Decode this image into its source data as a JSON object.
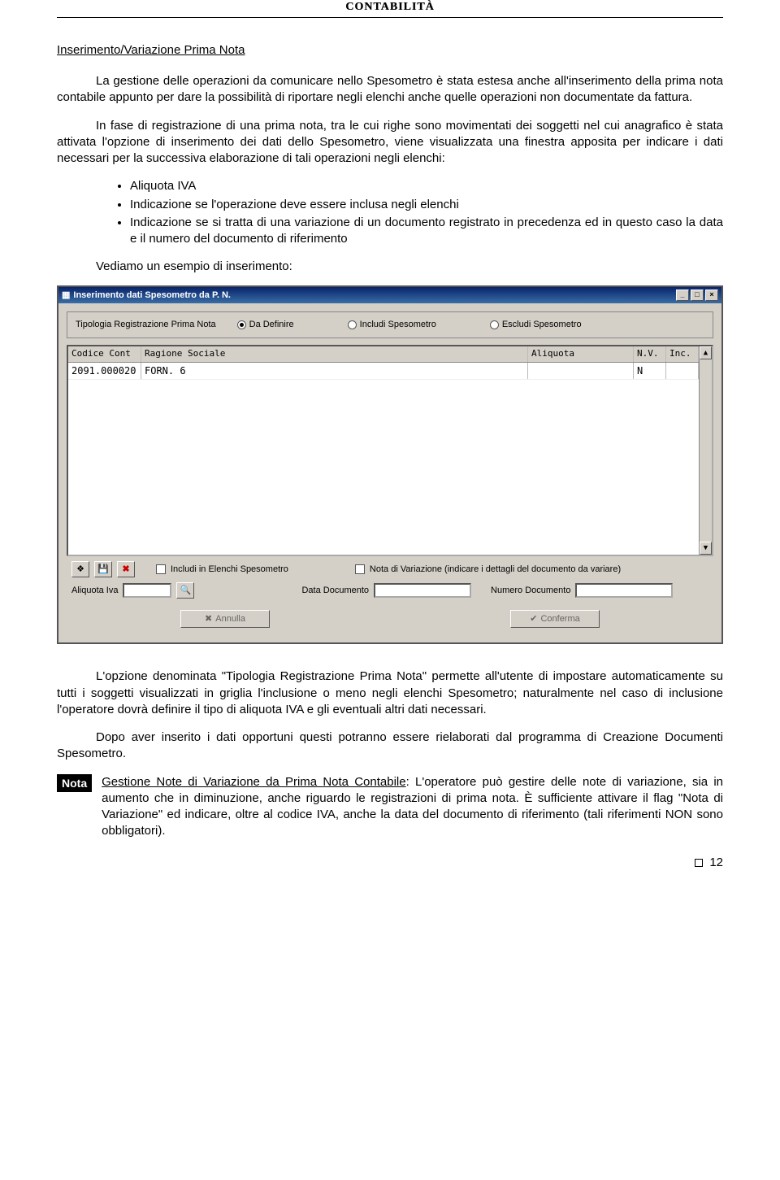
{
  "header": {
    "title": "CONTABILITÀ"
  },
  "section1": {
    "title": "Inserimento/Variazione Prima Nota",
    "p1": "La gestione delle operazioni da comunicare nello Spesometro è stata estesa anche all'inserimento della prima nota contabile appunto per dare la possibilità di riportare negli elenchi anche quelle operazioni non documentate da fattura.",
    "p2": "In fase di registrazione di una prima nota, tra le cui righe sono movimentati dei soggetti nel cui anagrafico è stata attivata l'opzione di inserimento dei dati dello Spesometro, viene visualizzata una finestra apposita per indicare i dati necessari per la successiva elaborazione di tali operazioni negli elenchi:",
    "bullets": [
      "Aliquota IVA",
      "Indicazione se l'operazione deve essere inclusa negli elenchi",
      "Indicazione se si tratta di una variazione di un documento registrato in precedenza ed in questo caso la data e il numero del documento di riferimento"
    ],
    "example": "Vediamo un esempio di inserimento:"
  },
  "dialog": {
    "title": "Inserimento dati Spesometro da P. N.",
    "radioLabel": "Tipologia Registrazione Prima Nota",
    "radios": [
      "Da Definire",
      "Includi Spesometro",
      "Escludi Spesometro"
    ],
    "cols": {
      "code": "Codice Cont",
      "rag": "Ragione Sociale",
      "aliq": "Aliquota",
      "nv": "N.V.",
      "inc": "Inc."
    },
    "row": {
      "code": "2091.000020",
      "rag": "FORN. 6",
      "aliq": "",
      "nv": "N",
      "inc": ""
    },
    "chkIncludi": "Includi in Elenchi Spesometro",
    "chkNota": "Nota di Variazione (indicare i dettagli del documento da variare)",
    "aliqLabel": "Aliquota Iva",
    "dataDocLabel": "Data Documento",
    "numDocLabel": "Numero Documento",
    "btnAnnulla": "Annulla",
    "btnConferma": "Conferma"
  },
  "section2": {
    "p1": "L'opzione denominata \"Tipologia Registrazione Prima Nota\" permette all'utente di impostare automaticamente su tutti i soggetti visualizzati in griglia l'inclusione o meno negli elenchi Spesometro; naturalmente nel caso di inclusione l'operatore dovrà definire il tipo di aliquota IVA e gli eventuali altri dati necessari.",
    "p2": "Dopo aver inserito i dati opportuni questi potranno essere rielaborati dal programma di Creazione Documenti Spesometro."
  },
  "note": {
    "badge": "Nota",
    "title": "Gestione Note di Variazione da Prima Nota Contabile",
    "body": "L'operatore può gestire delle note di variazione, sia in aumento che in diminuzione, anche riguardo le registrazioni di prima nota. È sufficiente attivare il flag \"Nota di Variazione\" ed indicare, oltre al codice IVA, anche la data del documento di riferimento (tali riferimenti NON sono obbligatori)."
  },
  "footer": {
    "page": "12"
  }
}
